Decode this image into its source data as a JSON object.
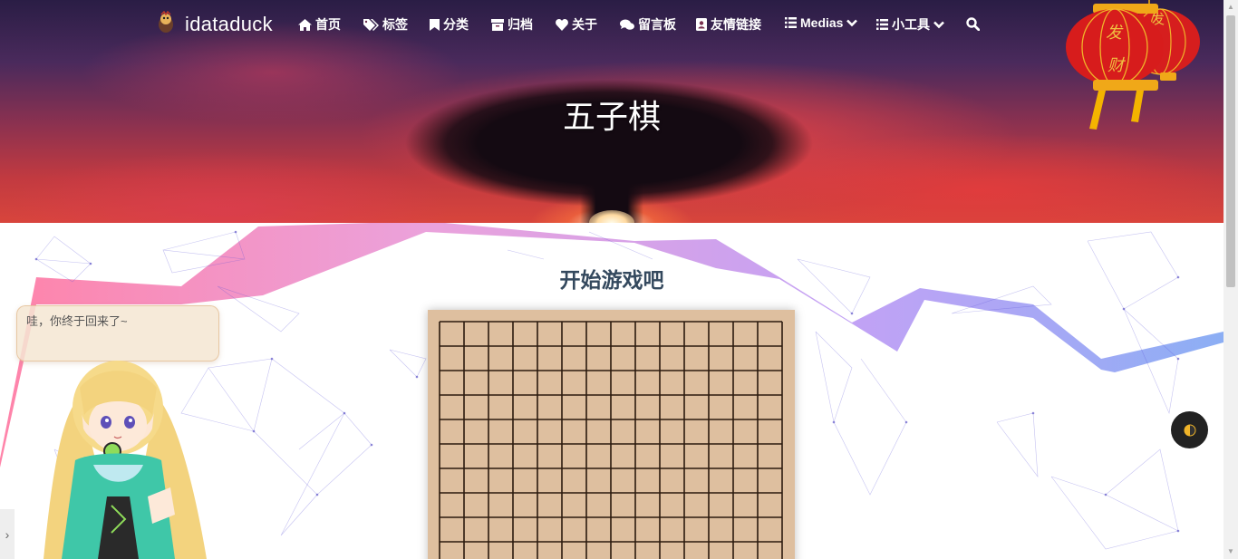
{
  "site": {
    "brand": "idataduck"
  },
  "nav": {
    "items": [
      {
        "label": "首页",
        "icon": "home-icon"
      },
      {
        "label": "标签",
        "icon": "tags-icon"
      },
      {
        "label": "分类",
        "icon": "bookmark-icon"
      },
      {
        "label": "归档",
        "icon": "archive-icon"
      },
      {
        "label": "关于",
        "icon": "heart-icon"
      },
      {
        "label": "留言板",
        "icon": "comments-icon"
      },
      {
        "label": "友情链接",
        "icon": "address-book-icon"
      },
      {
        "label": "Medias",
        "icon": "list-icon",
        "dropdown": true
      },
      {
        "label": "小工具",
        "icon": "list-icon",
        "dropdown": true
      }
    ],
    "search_icon": "search-icon"
  },
  "header": {
    "title": "五子棋"
  },
  "lanterns": {
    "left_chars": [
      "发",
      "财"
    ],
    "right_char": "发"
  },
  "game": {
    "title": "开始游戏吧",
    "board_color": "#debf9f",
    "line_color": "#2b1a0e"
  },
  "mascot": {
    "message": "哇，你终于回来了~"
  },
  "side_tab": {
    "label": "›"
  },
  "theme_toggle": {
    "icon": "half-moon-icon"
  },
  "colors": {
    "title_text": "#34495e",
    "nav_text": "#ffffff"
  }
}
